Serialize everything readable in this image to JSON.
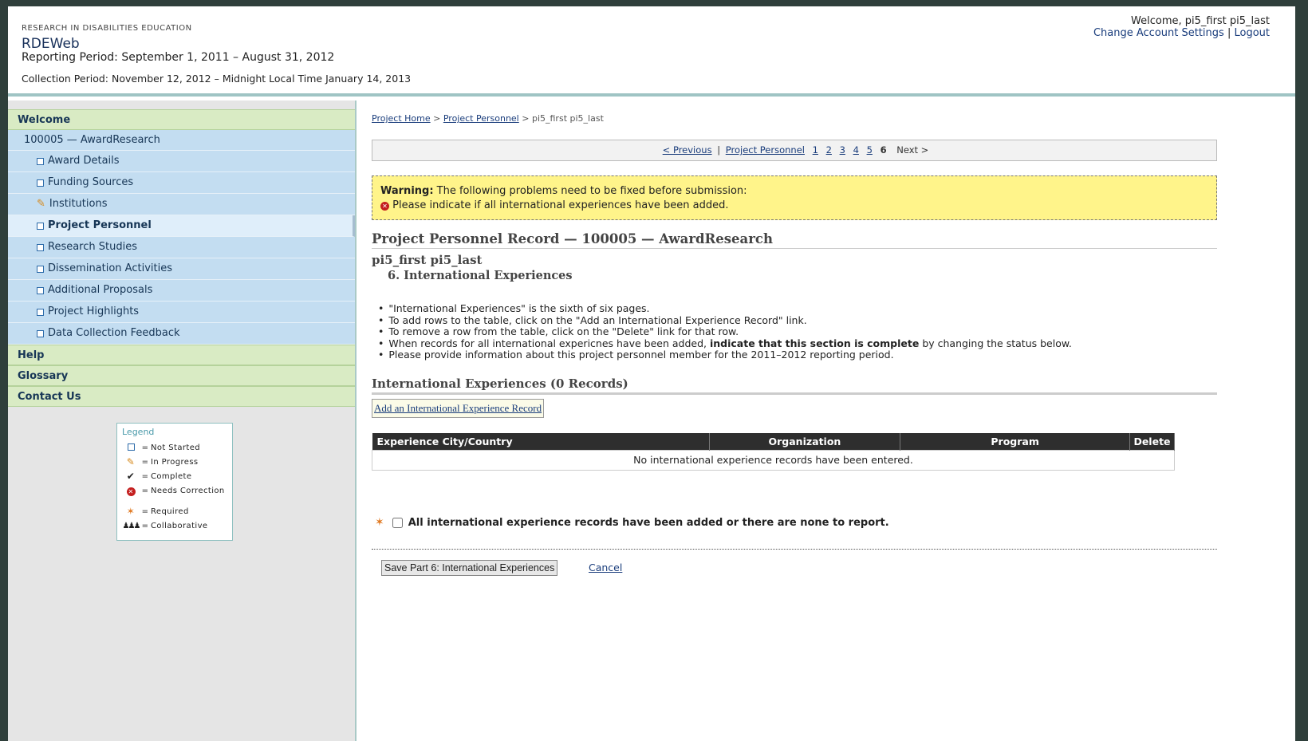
{
  "header": {
    "org": "RESEARCH IN DISABILITIES EDUCATION",
    "app": "RDEWeb",
    "reporting_period": "Reporting Period: September 1, 2011 – August 31, 2012",
    "collection_period": "Collection Period: November 12, 2012 – Midnight Local Time January 14, 2013",
    "welcome": "Welcome, pi5_first pi5_last",
    "account_settings": "Change Account Settings",
    "separator": "|",
    "logout": "Logout"
  },
  "sidebar": {
    "welcome": "Welcome",
    "award": "100005 — AwardResearch",
    "items": [
      {
        "label": "Award Details",
        "status": "not-started"
      },
      {
        "label": "Funding Sources",
        "status": "not-started"
      },
      {
        "label": "Institutions",
        "status": "in-progress"
      },
      {
        "label": "Project Personnel",
        "status": "not-started",
        "active": true
      },
      {
        "label": "Research Studies",
        "status": "not-started"
      },
      {
        "label": "Dissemination Activities",
        "status": "not-started"
      },
      {
        "label": "Additional Proposals",
        "status": "not-started"
      },
      {
        "label": "Project Highlights",
        "status": "not-started"
      },
      {
        "label": "Data Collection Feedback",
        "status": "not-started"
      }
    ],
    "help": "Help",
    "glossary": "Glossary",
    "contact": "Contact Us"
  },
  "legend": {
    "title": "Legend",
    "eq": "=",
    "not_started": "Not Started",
    "in_progress": "In Progress",
    "complete": "Complete",
    "needs_correction": "Needs Correction",
    "required": "Required",
    "collaborative": "Collaborative"
  },
  "breadcrumb": {
    "home": "Project Home",
    "personnel": "Project Personnel",
    "sep": ">",
    "current": "pi5_first pi5_last"
  },
  "pager": {
    "previous": "< Previous",
    "sep": "|",
    "personnel": "Project Personnel",
    "pages": [
      "1",
      "2",
      "3",
      "4",
      "5"
    ],
    "current": "6",
    "next": "Next >"
  },
  "warning": {
    "label": "Warning:",
    "text": "The following problems need to be fixed before submission:",
    "item": "Please indicate if all international experiences have been added."
  },
  "record_title": "Project Personnel Record — 100005 — AwardResearch",
  "person": "pi5_first pi5_last",
  "section": "6. International Experiences",
  "instructions": {
    "l1": "\"International Experiences\" is the sixth of six pages.",
    "l2": "To add rows to the table, click on the \"Add an International Experience Record\" link.",
    "l3": "To remove a row from the table, click on the \"Delete\" link for that row.",
    "l4_a": "When records for all international expericnes have been added,",
    "l4_b": "indicate that this section is complete",
    "l4_c": "by changing the status below.",
    "l5": "Please provide information about this project personnel member for the 2011–2012 reporting period."
  },
  "table": {
    "title": "International Experiences (0 Records)",
    "add_link": "Add an International Experience Record",
    "headers": [
      "Experience City/Country",
      "Organization",
      "Program",
      "Delete"
    ],
    "empty": "No international experience records have been entered."
  },
  "completion": {
    "star": "✶",
    "label": "All international experience records have been added or there are none to report.",
    "checked": false
  },
  "actions": {
    "save": "Save Part 6: International Experiences",
    "cancel": "Cancel"
  },
  "colors": {
    "nav_green": "#d9ebc4",
    "nav_blue": "#c3ddf1",
    "warning_bg": "#fff48a",
    "table_header": "#2e2e2e"
  }
}
